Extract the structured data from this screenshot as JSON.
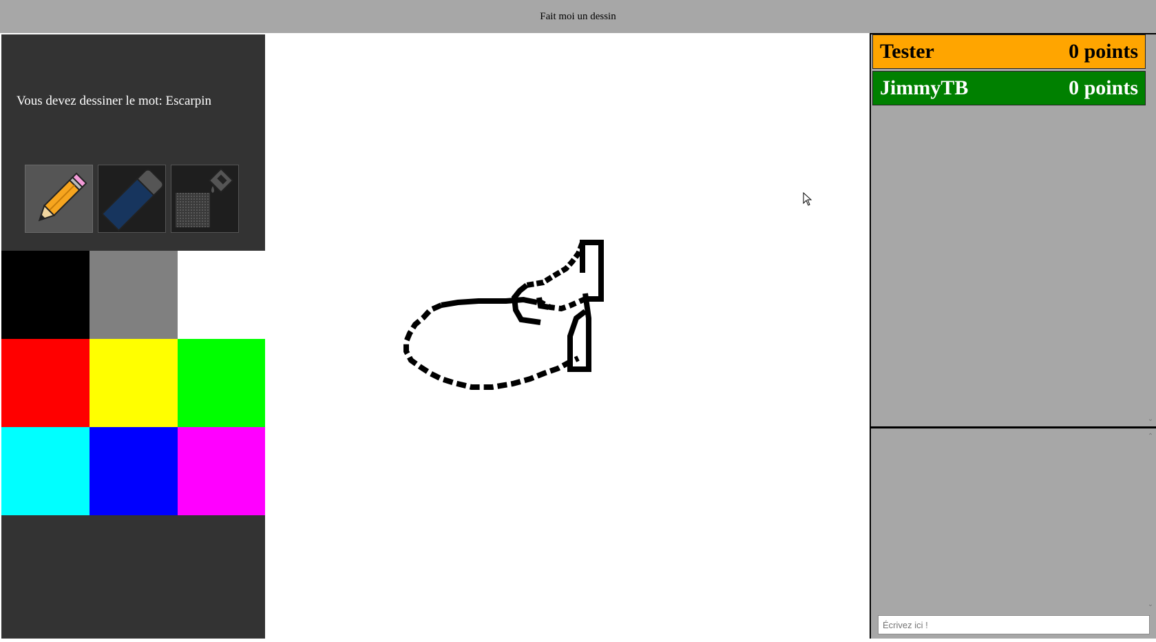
{
  "app": {
    "title": "Fait moi un dessin"
  },
  "left_panel": {
    "word_prompt": "Vous devez dessiner le mot: Escarpin",
    "tools": [
      {
        "name": "pencil",
        "icon": "pencil-icon",
        "active": true
      },
      {
        "name": "eraser",
        "icon": "eraser-icon",
        "active": false
      },
      {
        "name": "fill",
        "icon": "paint-bucket-icon",
        "active": false
      }
    ],
    "palette": [
      "#000000",
      "#808080",
      "#ffffff",
      "#ff0000",
      "#ffff00",
      "#00ff00",
      "#00ffff",
      "#0000ff",
      "#ff00ff"
    ]
  },
  "scoreboard": {
    "players": [
      {
        "name": "Tester",
        "points": "0 points",
        "bg": "#ffa500",
        "fg": "#000000"
      },
      {
        "name": "JimmyTB",
        "points": "0 points",
        "bg": "#008000",
        "fg": "#ffffff"
      }
    ]
  },
  "chat": {
    "placeholder": "Écrivez ici !",
    "value": ""
  }
}
